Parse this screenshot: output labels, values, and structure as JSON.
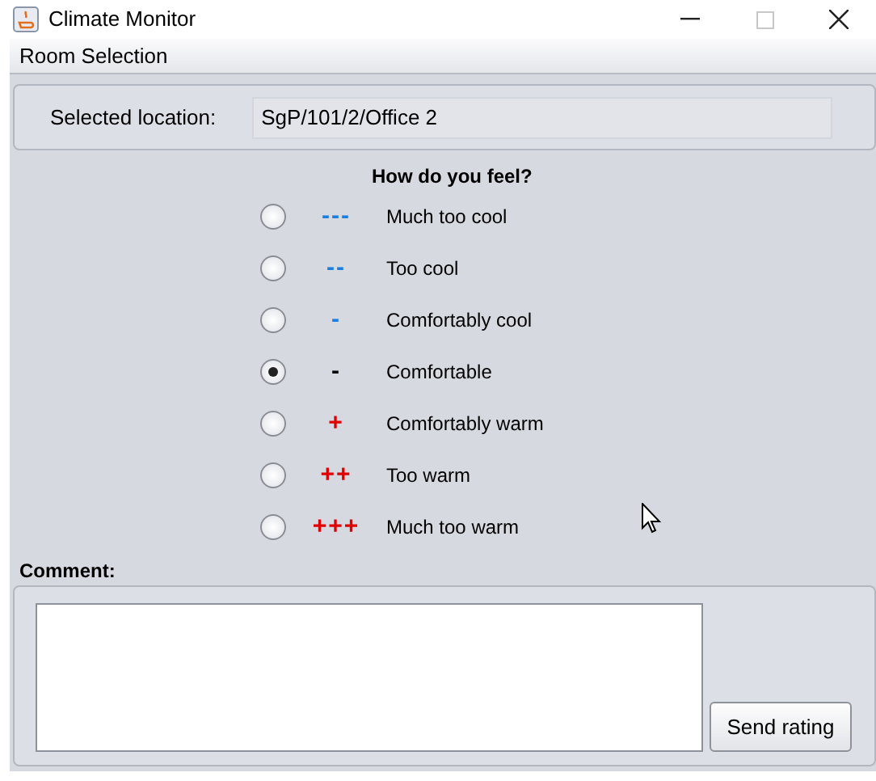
{
  "window": {
    "title": "Climate Monitor"
  },
  "menu": [
    "Room Selection"
  ],
  "location": {
    "label": "Selected location:",
    "value": "SgP/101/2/Office 2"
  },
  "question": "How do you feel?",
  "options": [
    {
      "symbol": "---",
      "color": "#1a7fe0",
      "label": "Much too cool",
      "selected": false
    },
    {
      "symbol": "--",
      "color": "#1a7fe0",
      "label": "Too cool",
      "selected": false
    },
    {
      "symbol": "-",
      "color": "#1a7fe0",
      "label": "Comfortably cool",
      "selected": false
    },
    {
      "symbol": "-",
      "color": "#000000",
      "label": "Comfortable",
      "selected": true
    },
    {
      "symbol": "+",
      "color": "#e00000",
      "label": "Comfortably warm",
      "selected": false
    },
    {
      "symbol": "++",
      "color": "#e00000",
      "label": "Too warm",
      "selected": false
    },
    {
      "symbol": "+++",
      "color": "#e00000",
      "label": "Much too warm",
      "selected": false
    }
  ],
  "comment": {
    "label": "Comment:"
  },
  "send_button": "Send rating"
}
